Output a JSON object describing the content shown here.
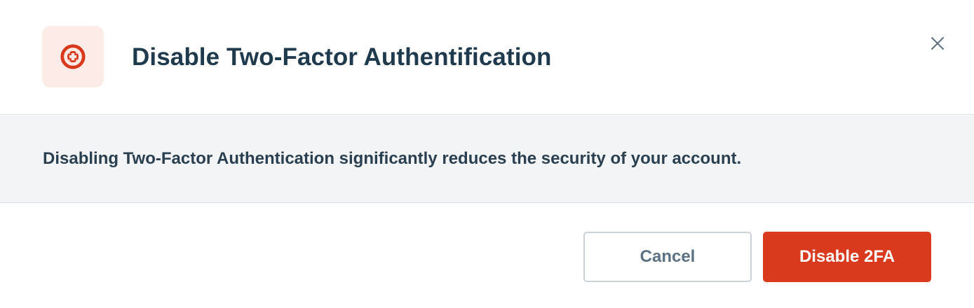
{
  "dialog": {
    "title": "Disable Two-Factor Authentification",
    "icon": "lifebuoy-icon",
    "close_icon": "close-icon",
    "message": "Disabling Two-Factor Authentication significantly reduces the security of your account.",
    "cancel_label": "Cancel",
    "confirm_label": "Disable 2FA"
  },
  "colors": {
    "danger": "#d93a1e",
    "danger_tint": "#fdebe7",
    "title_text": "#1f3a4d",
    "body_background": "#f3f4f6",
    "secondary_text": "#5c7282"
  }
}
